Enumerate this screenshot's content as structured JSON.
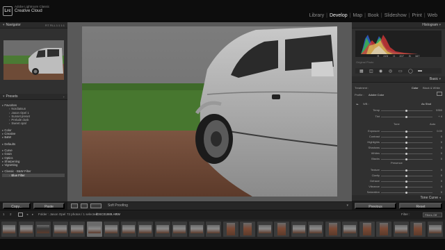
{
  "app": {
    "identity_line1": "Adobe Lightroom Classic",
    "identity_line2": "Creative Cloud",
    "logo": "Lrc"
  },
  "modules": [
    "Library",
    "Develop",
    "Map",
    "Book",
    "Slideshow",
    "Print",
    "Web"
  ],
  "active_module": "Develop",
  "left": {
    "navigator": {
      "title": "Navigator",
      "zoom_options": "FIT  FILL  1:1  1:1"
    },
    "presets": {
      "title": "Presets",
      "rows": [
        {
          "label": "Favorites",
          "kind": "folder"
        },
        {
          "label": "Nordiatsun",
          "kind": "item"
        },
        {
          "label": "Jason Opel 1",
          "kind": "item"
        },
        {
          "label": "Sunset preset",
          "kind": "item"
        },
        {
          "label": "Prelude dusk",
          "kind": "item"
        },
        {
          "label": "Sweet opal",
          "kind": "item"
        },
        {
          "label": "",
          "kind": "gap"
        },
        {
          "label": "Color",
          "kind": "folder"
        },
        {
          "label": "Creative",
          "kind": "folder"
        },
        {
          "label": "B&W",
          "kind": "folder"
        },
        {
          "label": "",
          "kind": "gap"
        },
        {
          "label": "Defaults",
          "kind": "folder"
        },
        {
          "label": "",
          "kind": "gap"
        },
        {
          "label": "Curve",
          "kind": "folder"
        },
        {
          "label": "Grain",
          "kind": "folder"
        },
        {
          "label": "Optics",
          "kind": "folder"
        },
        {
          "label": "Sharpening",
          "kind": "folder"
        },
        {
          "label": "Vignetting",
          "kind": "folder"
        },
        {
          "label": "",
          "kind": "gap"
        },
        {
          "label": "Classic - B&W Filter",
          "kind": "folder"
        },
        {
          "label": "Blue Filter",
          "kind": "item",
          "selected": true
        }
      ]
    },
    "copy_label": "Copy...",
    "paste_label": "Paste"
  },
  "right": {
    "histogram_title": "Histogram",
    "hist_values": [
      "223",
      "207",
      "167"
    ],
    "original_photo": "Original Photo",
    "basic_title": "Basic",
    "treatment": {
      "label": "Treatment :",
      "color": "Color",
      "bw": "Black & White"
    },
    "profile": {
      "label": "Profile :",
      "value": "Adobe Color"
    },
    "wb": {
      "label": "WB :",
      "value": "As Shot"
    },
    "sliders_group1": [
      {
        "label": "Temp",
        "value": "5350"
      },
      {
        "label": "Tint",
        "value": "+ 4"
      }
    ],
    "tone": {
      "label": "Tone",
      "auto": "Auto"
    },
    "sliders_group2": [
      {
        "label": "Exposure",
        "value": "0.00"
      },
      {
        "label": "Contrast",
        "value": "0"
      },
      {
        "label": "Highlights",
        "value": "0"
      },
      {
        "label": "Shadows",
        "value": "0"
      },
      {
        "label": "Whites",
        "value": "0"
      },
      {
        "label": "Blacks",
        "value": "0"
      }
    ],
    "presence_label": "Presence",
    "sliders_group3": [
      {
        "label": "Texture",
        "value": "0"
      },
      {
        "label": "Clarity",
        "value": "0"
      },
      {
        "label": "Dehaze",
        "value": "0"
      },
      {
        "label": "Vibrance",
        "value": "0"
      },
      {
        "label": "Saturation",
        "value": "0"
      }
    ],
    "tone_curve_title": "Tone Curve",
    "previous_label": "Previous",
    "reset_label": "Reset"
  },
  "toolbar": {
    "soft_proofing": "Soft Proofing"
  },
  "filmbar": {
    "page1": "1",
    "page2": "2",
    "folder": "Folder : Jason Opel",
    "count": "72 photos / 1 selected",
    "filename": "/DSC01989.ARW",
    "filter_label": "Filter :",
    "filter_value": "Filters Off"
  },
  "filmstrip": {
    "thumbs": [
      {
        "tone": "car",
        "orient": "land"
      },
      {
        "tone": "car",
        "orient": "land"
      },
      {
        "tone": "dark",
        "orient": "land"
      },
      {
        "tone": "car",
        "orient": "land"
      },
      {
        "tone": "car",
        "orient": "land"
      },
      {
        "tone": "car",
        "orient": "land",
        "selected": true
      },
      {
        "tone": "car",
        "orient": "land"
      },
      {
        "tone": "car",
        "orient": "land"
      },
      {
        "tone": "car",
        "orient": "land"
      },
      {
        "tone": "car",
        "orient": "land"
      },
      {
        "tone": "car",
        "orient": "land"
      },
      {
        "tone": "car",
        "orient": "land"
      },
      {
        "tone": "car",
        "orient": "land"
      },
      {
        "tone": "red",
        "orient": "port"
      },
      {
        "tone": "red",
        "orient": "port"
      },
      {
        "tone": "car",
        "orient": "land"
      },
      {
        "tone": "red",
        "orient": "port"
      },
      {
        "tone": "car",
        "orient": "land"
      },
      {
        "tone": "car",
        "orient": "land"
      },
      {
        "tone": "red",
        "orient": "port"
      },
      {
        "tone": "car",
        "orient": "land"
      },
      {
        "tone": "red",
        "orient": "port"
      },
      {
        "tone": "red",
        "orient": "port"
      },
      {
        "tone": "car",
        "orient": "land"
      },
      {
        "tone": "red",
        "orient": "port"
      },
      {
        "tone": "car",
        "orient": "land"
      }
    ]
  },
  "colors": {
    "active_module": "#f2f2f2",
    "panel": "#303030",
    "background": "#1a1a1a"
  }
}
